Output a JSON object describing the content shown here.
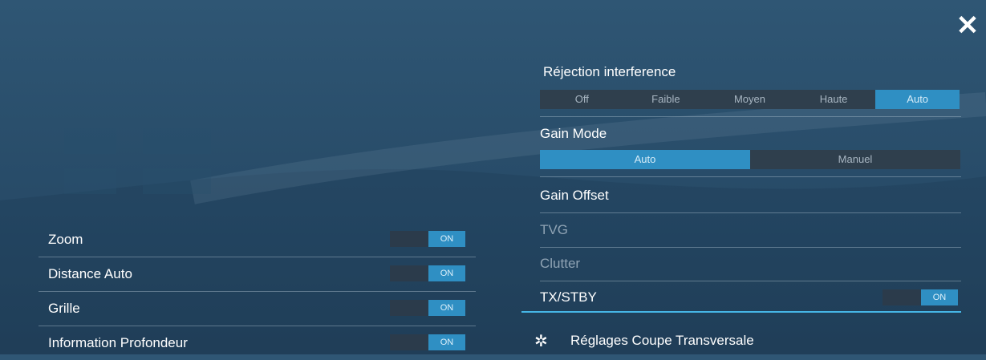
{
  "close_label": "✕",
  "left_toggles": [
    {
      "label": "Zoom",
      "state": "ON"
    },
    {
      "label": "Distance Auto",
      "state": "ON"
    },
    {
      "label": "Grille",
      "state": "ON"
    },
    {
      "label": "Information Profondeur",
      "state": "ON"
    }
  ],
  "rejection": {
    "title": "Réjection interference",
    "options": [
      "Off",
      "Faible",
      "Moyen",
      "Haute",
      "Auto"
    ],
    "selected": "Auto"
  },
  "gain_mode": {
    "title": "Gain Mode",
    "options": [
      "Auto",
      "Manuel"
    ],
    "selected": "Auto"
  },
  "items": {
    "gain_offset": "Gain Offset",
    "tvg": "TVG",
    "clutter": "Clutter",
    "tx_stby": "TX/STBY",
    "tx_stby_state": "ON"
  },
  "footer": {
    "icon": "gear-icon",
    "label": "Réglages Coupe Transversale"
  },
  "colors": {
    "accent": "#2f8fc3",
    "highlight_line": "#46b6e6"
  }
}
